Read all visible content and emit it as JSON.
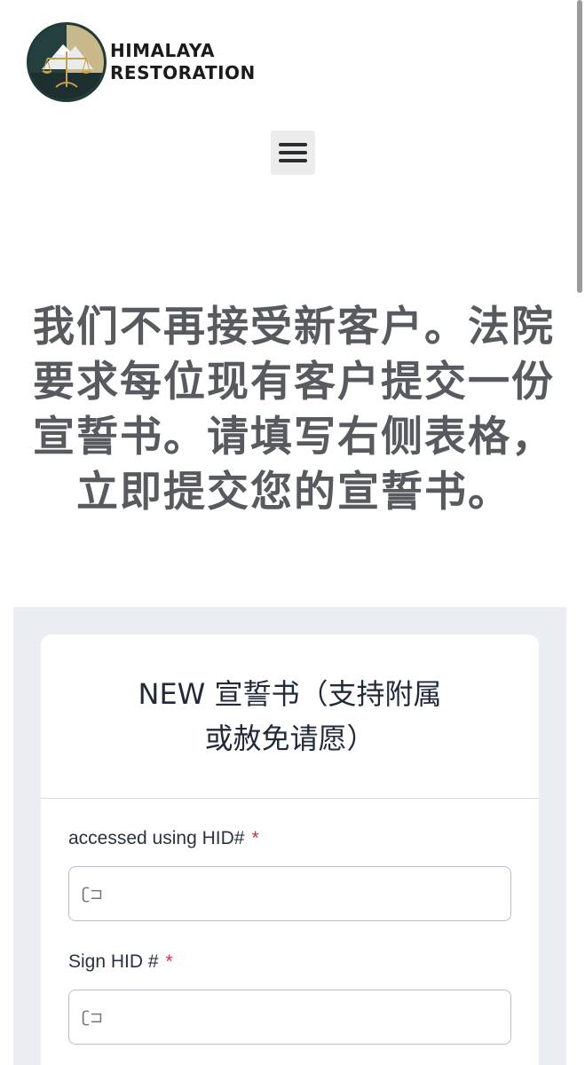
{
  "header": {
    "logo_line1": "HIMALAYA",
    "logo_line2": "RESTORATION",
    "menu_icon": "hamburger-menu-icon"
  },
  "headline": "我们不再接受新客户。法院要求每位现有客户提交一份宣誓书。请填写右侧表格，立即提交您的宣誓书。",
  "form": {
    "title_line1": "NEW 宣誓书（支持附属",
    "title_line2": "或赦免请愿）",
    "fields": [
      {
        "label": "accessed using HID#",
        "required_mark": "*",
        "placeholder": "ʗ⊐"
      },
      {
        "label": "Sign HID #",
        "required_mark": "*",
        "placeholder": "ʗ⊐"
      }
    ]
  },
  "colors": {
    "headline": "#575b60",
    "required": "#d32f45",
    "form_background": "#eaedf2",
    "menu_button": "#ececec"
  }
}
